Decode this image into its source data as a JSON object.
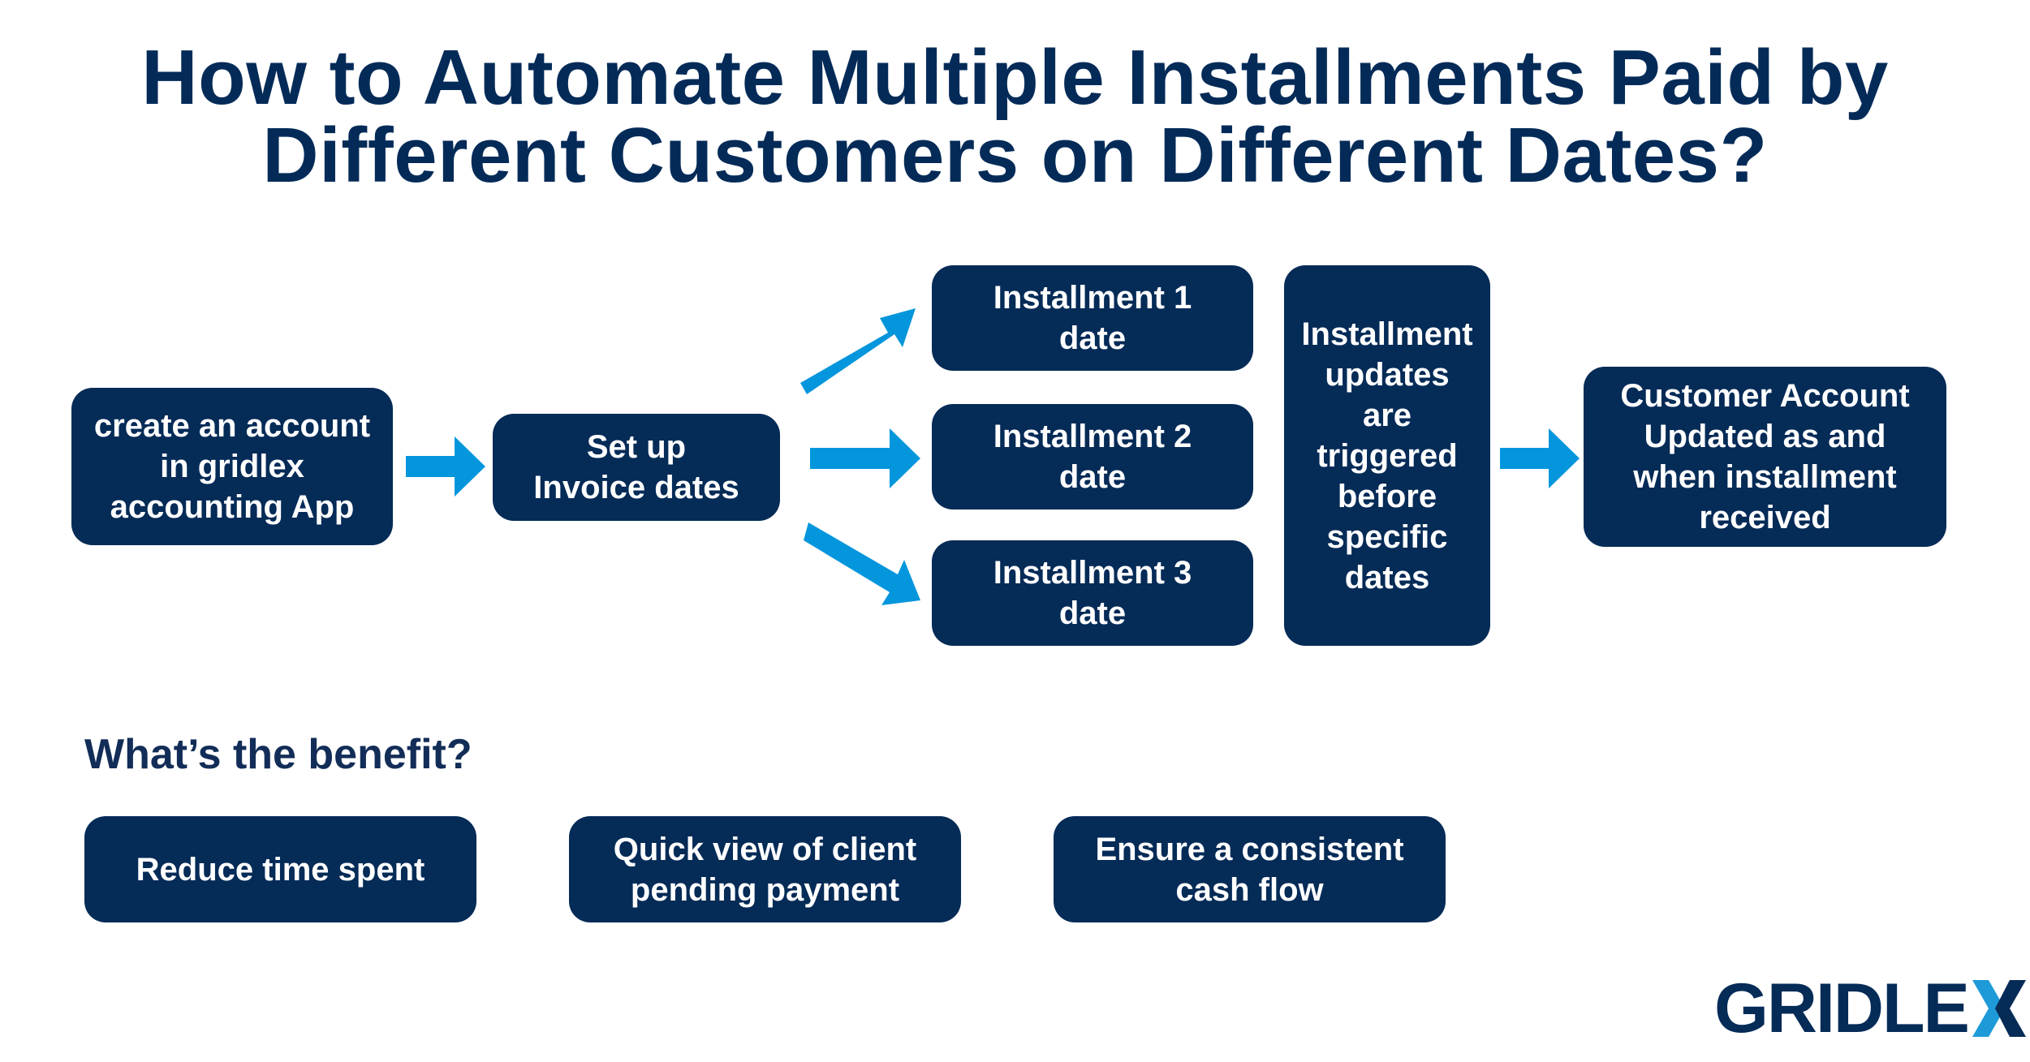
{
  "title": {
    "line1": "How to Automate Multiple Installments Paid by",
    "line2": "Different Customers on Different Dates?"
  },
  "flow": {
    "step1": "create an account\nin gridlex\naccounting App",
    "step2": "Set up\nInvoice dates",
    "installments": [
      "Installment 1\ndate",
      "Installment 2\ndate",
      "Installment 3\ndate"
    ],
    "trigger": "Installment\nupdates\nare\ntriggered\nbefore\nspecific\ndates",
    "result": "Customer Account\nUpdated as and\nwhen installment\nreceived"
  },
  "benefits": {
    "heading": "What’s the benefit?",
    "items": [
      "Reduce time spent",
      "Quick view of client\npending payment",
      "Ensure a consistent\ncash flow"
    ]
  },
  "logo": {
    "text": "GRIDLE",
    "mark": "X"
  },
  "colors": {
    "box": "#052b57",
    "arrow": "#0496dc",
    "title": "#042b58",
    "logo_accent": "#1e9ad8"
  }
}
